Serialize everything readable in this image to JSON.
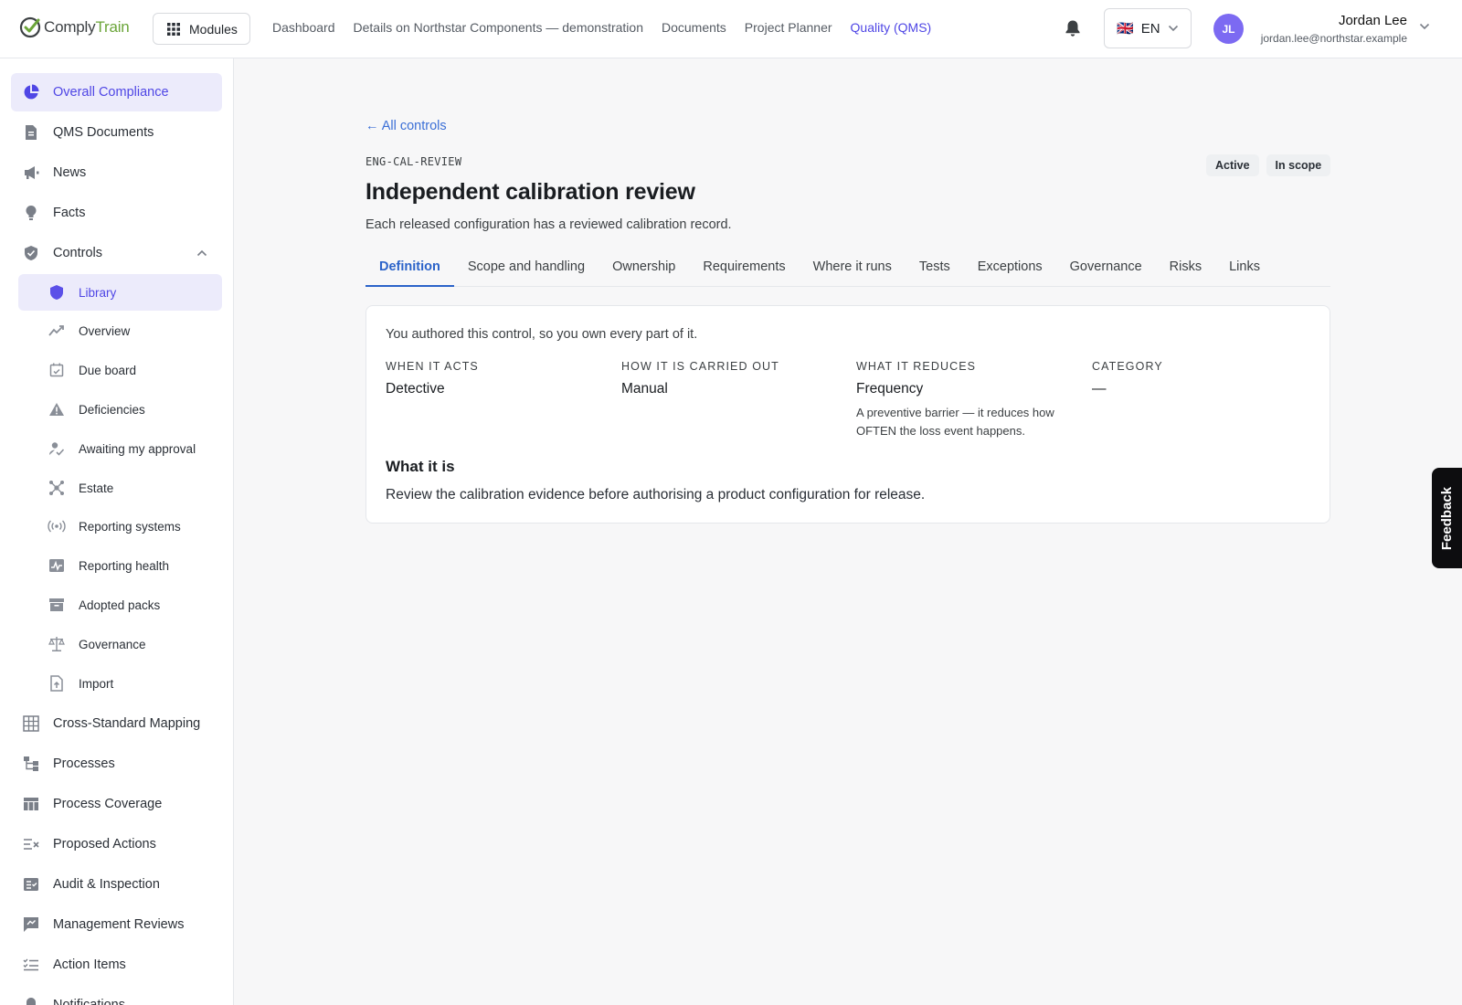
{
  "app": {
    "logo_part1": "Comply",
    "logo_part2": "Train",
    "brand_color": "#6ba539",
    "accent_color": "#4f46e5"
  },
  "topbar": {
    "modules_label": "Modules",
    "nav": [
      {
        "label": "Dashboard",
        "active": false
      },
      {
        "label": "Details on Northstar Components — demonstration",
        "active": false
      },
      {
        "label": "Documents",
        "active": false
      },
      {
        "label": "Project Planner",
        "active": false
      },
      {
        "label": "Quality (QMS)",
        "active": true
      }
    ],
    "language": "EN",
    "language_flag": "🇬🇧",
    "user": {
      "initials": "JL",
      "name": "Jordan Lee",
      "email": "jordan.lee@northstar.example"
    }
  },
  "sidebar": {
    "items_top": [
      {
        "label": "Overall Compliance",
        "icon": "pie-chart-icon",
        "active": true
      },
      {
        "label": "QMS Documents",
        "icon": "document-icon"
      },
      {
        "label": "News",
        "icon": "megaphone-icon"
      },
      {
        "label": "Facts",
        "icon": "lightbulb-icon"
      },
      {
        "label": "Controls",
        "icon": "shield-check-icon",
        "expanded": true
      }
    ],
    "controls_sub": [
      {
        "label": "Library",
        "icon": "shield-icon",
        "active": true
      },
      {
        "label": "Overview",
        "icon": "trend-icon"
      },
      {
        "label": "Due board",
        "icon": "calendar-check-icon"
      },
      {
        "label": "Deficiencies",
        "icon": "warning-icon"
      },
      {
        "label": "Awaiting my approval",
        "icon": "user-check-icon"
      },
      {
        "label": "Estate",
        "icon": "network-icon"
      },
      {
        "label": "Reporting systems",
        "icon": "broadcast-icon"
      },
      {
        "label": "Reporting health",
        "icon": "health-chart-icon"
      },
      {
        "label": "Adopted packs",
        "icon": "archive-icon"
      },
      {
        "label": "Governance",
        "icon": "scales-icon"
      },
      {
        "label": "Import",
        "icon": "file-upload-icon"
      }
    ],
    "items_bottom": [
      {
        "label": "Cross-Standard Mapping",
        "icon": "grid-icon"
      },
      {
        "label": "Processes",
        "icon": "process-icon"
      },
      {
        "label": "Process Coverage",
        "icon": "table-icon"
      },
      {
        "label": "Proposed Actions",
        "icon": "list-x-icon"
      },
      {
        "label": "Audit & Inspection",
        "icon": "checklist-icon"
      },
      {
        "label": "Management Reviews",
        "icon": "review-icon"
      },
      {
        "label": "Action Items",
        "icon": "list-check-icon"
      },
      {
        "label": "Notifications",
        "icon": "bell-icon"
      }
    ]
  },
  "main": {
    "back_label": "← All controls",
    "control_code": "ENG-CAL-REVIEW",
    "badges": [
      "Active",
      "In scope"
    ],
    "title": "Independent calibration review",
    "subtitle": "Each released configuration has a reviewed calibration record.",
    "tabs": [
      "Definition",
      "Scope and handling",
      "Ownership",
      "Requirements",
      "Where it runs",
      "Tests",
      "Exceptions",
      "Governance",
      "Risks",
      "Links"
    ],
    "active_tab": "Definition",
    "card": {
      "owner_note": "You authored this control, so you own every part of it.",
      "attributes": [
        {
          "label": "WHEN IT ACTS",
          "value": "Detective",
          "note": ""
        },
        {
          "label": "HOW IT IS CARRIED OUT",
          "value": "Manual",
          "note": ""
        },
        {
          "label": "WHAT IT REDUCES",
          "value": "Frequency",
          "note": "A preventive barrier — it reduces how OFTEN the loss event happens."
        },
        {
          "label": "CATEGORY",
          "value": "—",
          "note": ""
        }
      ],
      "section_title": "What it is",
      "section_body": "Review the calibration evidence before authorising a product configuration for release."
    }
  },
  "feedback_label": "Feedback"
}
